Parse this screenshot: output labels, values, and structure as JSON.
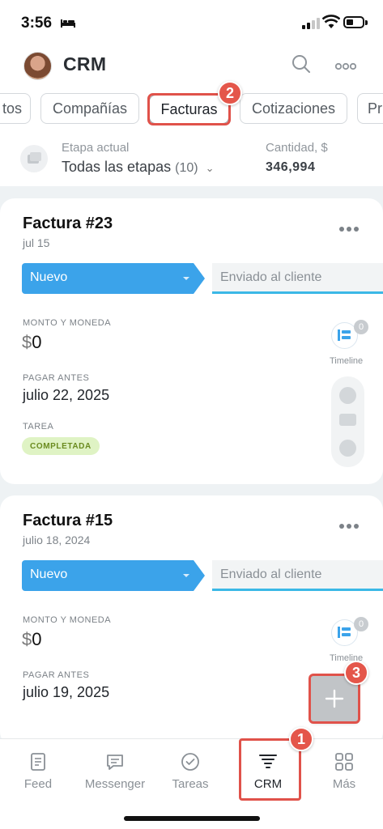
{
  "status": {
    "time": "3:56"
  },
  "header": {
    "title": "CRM"
  },
  "tabs": [
    {
      "label": "tos"
    },
    {
      "label": "Compañías"
    },
    {
      "label": "Facturas",
      "active": true
    },
    {
      "label": "Cotizaciones"
    },
    {
      "label": "Pr"
    }
  ],
  "stage": {
    "label": "Etapa actual",
    "value": "Todas las etapas",
    "count": "(10)",
    "amount_label": "Cantidad, $",
    "amount_value": "346,994"
  },
  "cards": [
    {
      "title": "Factura #23",
      "date": "jul 15",
      "stage": "Nuevo",
      "next_stage": "Enviado al cliente",
      "amount_label": "MONTO Y MONEDA",
      "currency": "$",
      "amount": "0",
      "due_label": "PAGAR ANTES",
      "due_value": "julio 22, 2025",
      "task_label": "TAREA",
      "task_status": "COMPLETADA",
      "timeline_count": "0",
      "timeline_label": "Timeline"
    },
    {
      "title": "Factura #15",
      "date": "julio 18, 2024",
      "stage": "Nuevo",
      "next_stage": "Enviado al cliente",
      "amount_label": "MONTO Y MONEDA",
      "currency": "$",
      "amount": "0",
      "due_label": "PAGAR ANTES",
      "due_value": "julio 19, 2025",
      "timeline_count": "0",
      "timeline_label": "Timeline"
    }
  ],
  "annotations": {
    "one": "1",
    "two": "2",
    "three": "3"
  },
  "nav": [
    {
      "label": "Feed",
      "icon": "feed-icon"
    },
    {
      "label": "Messenger",
      "icon": "chat-icon"
    },
    {
      "label": "Tareas",
      "icon": "check-circle-icon"
    },
    {
      "label": "CRM",
      "icon": "funnel-icon",
      "active": true
    },
    {
      "label": "Más",
      "icon": "grid-icon"
    }
  ],
  "colors": {
    "accent_blue": "#3ba3ea",
    "highlight_red": "#e0524a",
    "task_green_bg": "#dff3c4"
  }
}
